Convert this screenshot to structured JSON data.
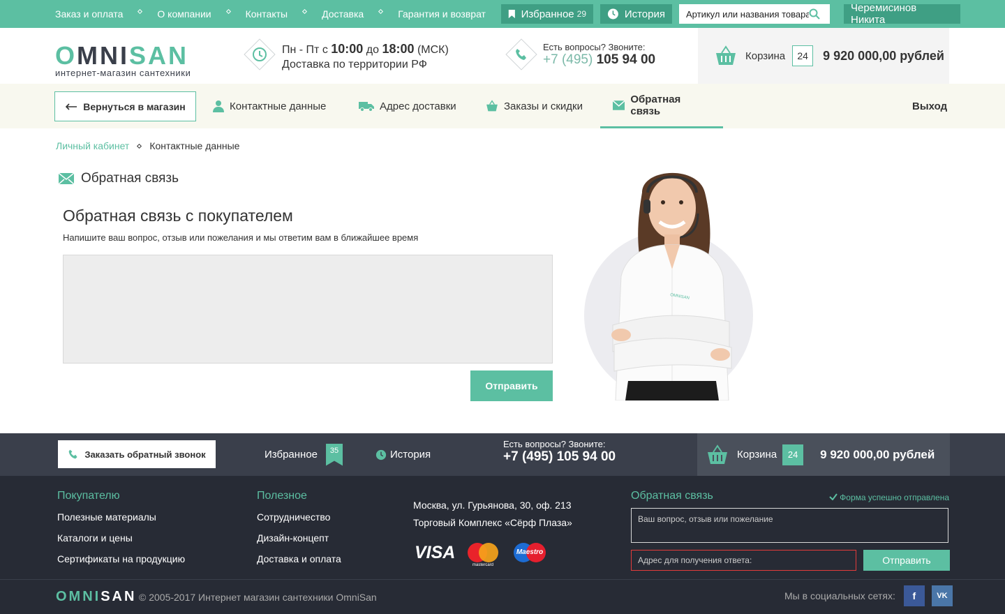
{
  "topbar": {
    "nav": [
      "Заказ и оплата",
      "О компании",
      "Контакты",
      "Доставка",
      "Гарантия и возврат"
    ],
    "favorites_label": "Избранное",
    "favorites_count": "29",
    "history_label": "История",
    "search_placeholder": "Артикул или названия товара",
    "user_name": "Черемисинов Никита"
  },
  "header": {
    "logo_a": "O",
    "logo_b": "MNI",
    "logo_c": "SAN",
    "logo_sub": "интернет-магазин сантехники",
    "hours_line1_pre": "Пн - Пт с ",
    "hours_from": "10:00",
    "hours_mid": " до ",
    "hours_to": "18:00",
    "hours_tz": " (МСК)",
    "hours_line2": "Доставка по территории РФ",
    "phone_question": "Есть вопросы? Звоните:",
    "phone_code": "+7 (495)",
    "phone_number": "105 94 00",
    "cart_label": "Корзина",
    "cart_count": "24",
    "cart_sum": "9 920 000,00 рублей"
  },
  "account_nav": {
    "back": "Вернуться в магазин",
    "items": [
      "Контактные данные",
      "Адрес доставки",
      "Заказы и скидки",
      "Обратная связь"
    ],
    "logout": "Выход"
  },
  "breadcrumb": {
    "root": "Личный кабинет",
    "current": "Контактные данные"
  },
  "main": {
    "section_title": "Обратная связь",
    "form_heading": "Обратная связь с покупателем",
    "form_desc": "Напишите ваш вопрос, отзыв или пожелания и мы ответим вам в ближайшее время",
    "submit": "Отправить"
  },
  "footer_top": {
    "callback": "Заказать обратный звонок",
    "favorites_label": "Избранное",
    "favorites_count": "35",
    "history_label": "История",
    "phone_question": "Есть вопросы? Звоните:",
    "phone": "+7 (495) 105 94 00",
    "cart_label": "Корзина",
    "cart_count": "24",
    "cart_sum": "9 920 000,00 рублей"
  },
  "footer": {
    "col1_title": "Покупателю",
    "col1_links": [
      "Полезные материалы",
      "Каталоги и цены",
      "Сертификаты на продукцию"
    ],
    "col2_title": "Полезное",
    "col2_links": [
      "Сотрудничество",
      "Дизайн-концепт",
      "Доставка и оплата"
    ],
    "address_line1": "Москва, ул. Гурьянова, 30, оф. 213",
    "address_line2": "Торговый Комплекс «Сёрф Плаза»",
    "visa": "VISA",
    "mastercard": "mastercard",
    "maestro": "Maestro",
    "feedback_title": "Обратная связь",
    "feedback_ok": "Форма успешно отправлена",
    "feedback_placeholder": "Ваш вопрос, отзыв или пожелание",
    "address_placeholder": "Адрес для получения ответа:",
    "feedback_send": "Отправить",
    "logo_a": "OMNI",
    "logo_b": "SAN",
    "copyright": "© 2005-2017 Интернет магазин сантехники OmniSan",
    "social_label": "Мы в социальных сетях:",
    "fb": "f",
    "vk": "VK"
  },
  "colors": {
    "accent": "#5cbfa2",
    "accent_dark": "#3f9f84",
    "footer_dark": "#272b35",
    "footer_mid": "#3a3f4b"
  }
}
